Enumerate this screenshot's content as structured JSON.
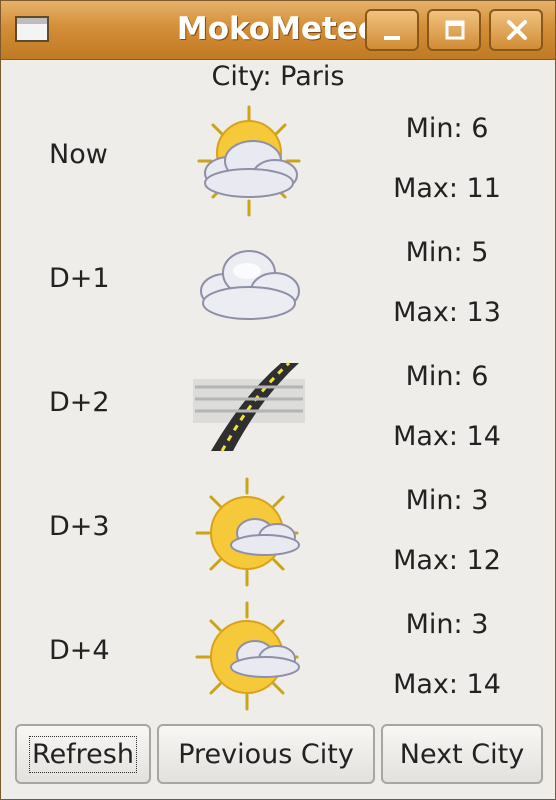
{
  "window": {
    "title": "MokoMeteo"
  },
  "city_label": "City: Paris",
  "forecast": [
    {
      "day": "Now",
      "icon": "partly-cloudy-sun-icon",
      "min": "Min: 6",
      "max": "Max: 11"
    },
    {
      "day": "D+1",
      "icon": "cloudy-icon",
      "min": "Min: 5",
      "max": "Max: 13"
    },
    {
      "day": "D+2",
      "icon": "fog-road-icon",
      "min": "Min: 6",
      "max": "Max: 14"
    },
    {
      "day": "D+3",
      "icon": "sun-cloud-icon",
      "min": "Min: 3",
      "max": "Max: 12"
    },
    {
      "day": "D+4",
      "icon": "sun-cloud-icon",
      "min": "Min: 3",
      "max": "Max: 14"
    }
  ],
  "buttons": {
    "refresh": "Refresh",
    "previous": "Previous City",
    "next": "Next City"
  },
  "colors": {
    "titlebar": "#d38e37",
    "background": "#efedea"
  }
}
